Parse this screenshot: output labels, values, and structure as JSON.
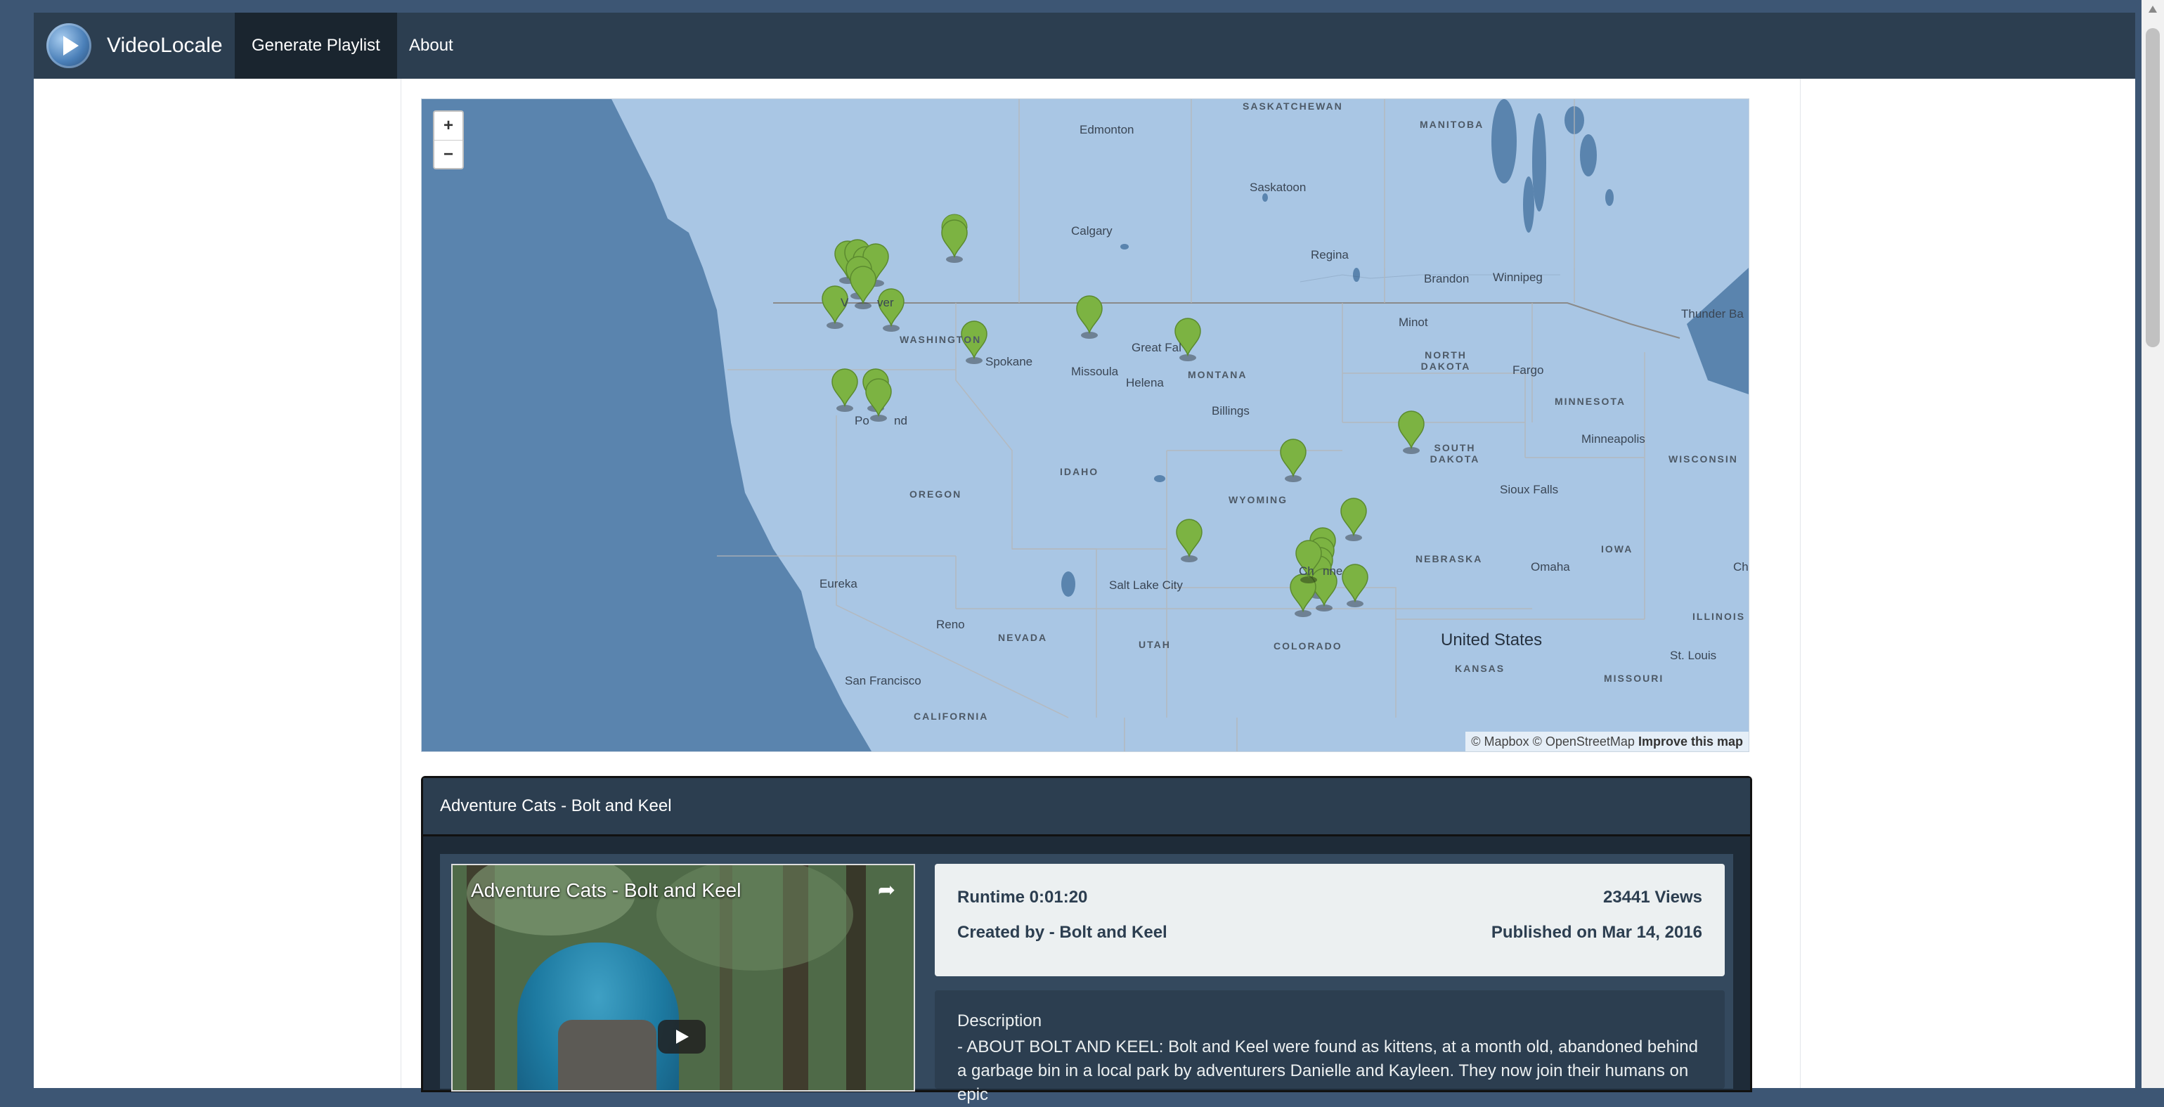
{
  "navbar": {
    "brand": "VideoLocale",
    "items": [
      "Generate Playlist",
      "About"
    ]
  },
  "map": {
    "zoom_in": "+",
    "zoom_out": "−",
    "attribution_mapbox": "© Mapbox",
    "attribution_osm": "© OpenStreetMap",
    "improve": "Improve this map",
    "labels": {
      "saskatchewan": "SASKATCHEWAN",
      "manitoba": "MANITOBA",
      "edmonton": "Edmonton",
      "saskatoon": "Saskatoon",
      "calgary": "Calgary",
      "regina": "Regina",
      "brandon": "Brandon",
      "winnipeg": "Winnipeg",
      "thunder_bay": "Thunder Ba",
      "minot": "Minot",
      "north_dakota": "NORTH DAKOTA",
      "fargo": "Fargo",
      "minnesota": "MINNESOTA",
      "minneapolis": "Minneapolis",
      "wisconsin": "WISCONSIN",
      "washington": "WASHINGTON",
      "spokane": "Spokane",
      "missoula": "Missoula",
      "great_falls": "Great Fal",
      "helena": "Helena",
      "montana": "MONTANA",
      "billings": "Billings",
      "south_dakota": "SOUTH DAKOTA",
      "sioux_falls": "Sioux Falls",
      "oregon": "OREGON",
      "idaho": "IDAHO",
      "wyoming": "WYOMING",
      "nebraska": "NEBRASKA",
      "omaha": "Omaha",
      "iowa": "IOWA",
      "eureka": "Eureka",
      "salt_lake": "Salt Lake City",
      "reno": "Reno",
      "nevada": "NEVADA",
      "utah": "UTAH",
      "colorado": "COLORADO",
      "united_states": "United States",
      "kansas": "KANSAS",
      "missouri": "MISSOURI",
      "st_louis": "St. Louis",
      "illinois": "ILLINOIS",
      "san_francisco": "San Francisco",
      "california": "CALIFORNIA",
      "portland_partial": "Po",
      "portland_partial2": "nd",
      "vancouver_partial": "V",
      "vancouver_partial2": "ver",
      "cheyenne_partial": "Ch",
      "cheyenne_partial2": "nne",
      "chicago_partial": "Ch"
    },
    "marker_count": 30
  },
  "card": {
    "title": "Adventure Cats - Bolt and Keel",
    "video": {
      "title": "Adventure Cats - Bolt and Keel"
    },
    "runtime": "Runtime 0:01:20",
    "views": "23441 Views",
    "created_by": "Created by - Bolt and Keel",
    "published": "Published on Mar 14, 2016",
    "description_label": "Description",
    "description": "- ABOUT BOLT AND KEEL: Bolt and Keel were found as kittens, at a month old, abandoned behind a garbage bin in a local park by adventurers Danielle and Kayleen. They now join their humans on epic"
  },
  "colors": {
    "navbar": "#2c3e50",
    "nav_active": "#1a252f",
    "body_bg": "#3d5674",
    "marker": "#7cb342"
  }
}
